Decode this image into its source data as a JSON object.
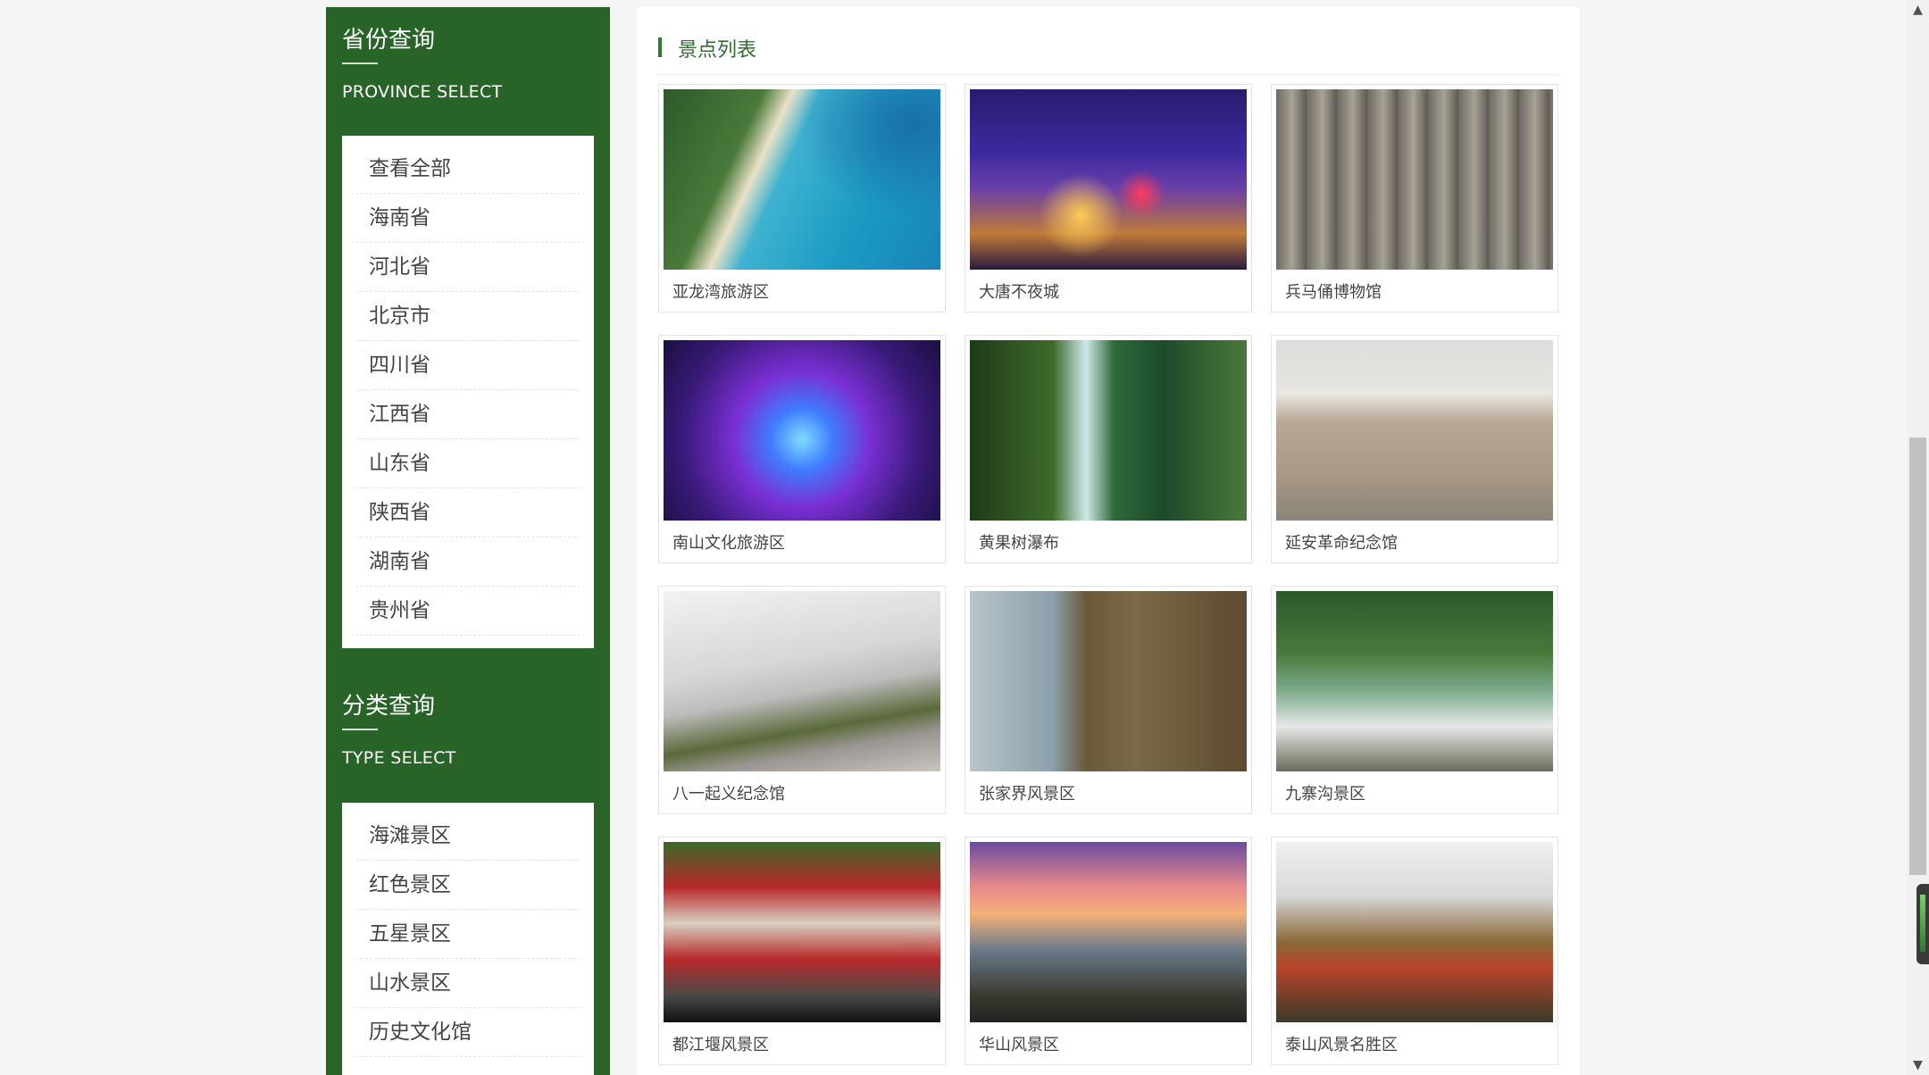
{
  "sidebar": {
    "province": {
      "title": "省份查询",
      "subtitle": "PROVINCE SELECT",
      "items": [
        "查看全部",
        "海南省",
        "河北省",
        "北京市",
        "四川省",
        "江西省",
        "山东省",
        "陕西省",
        "湖南省",
        "贵州省"
      ]
    },
    "type": {
      "title": "分类查询",
      "subtitle": "TYPE SELECT",
      "items": [
        "海滩景区",
        "红色景区",
        "五星景区",
        "山水景区",
        "历史文化馆"
      ]
    }
  },
  "main": {
    "title": "景点列表",
    "spots": [
      {
        "name": "亚龙湾旅游区"
      },
      {
        "name": "大唐不夜城"
      },
      {
        "name": "兵马俑博物馆"
      },
      {
        "name": "南山文化旅游区"
      },
      {
        "name": "黄果树瀑布"
      },
      {
        "name": "延安革命纪念馆"
      },
      {
        "name": "八一起义纪念馆"
      },
      {
        "name": "张家界风景区"
      },
      {
        "name": "九寨沟景区"
      },
      {
        "name": "都江堰风景区"
      },
      {
        "name": "华山风景区"
      },
      {
        "name": "泰山风景名胜区"
      }
    ]
  },
  "colors": {
    "sidebar_bg": "#286428",
    "heading_green": "#2f6e2f",
    "page_bg": "#f5f5f5"
  }
}
